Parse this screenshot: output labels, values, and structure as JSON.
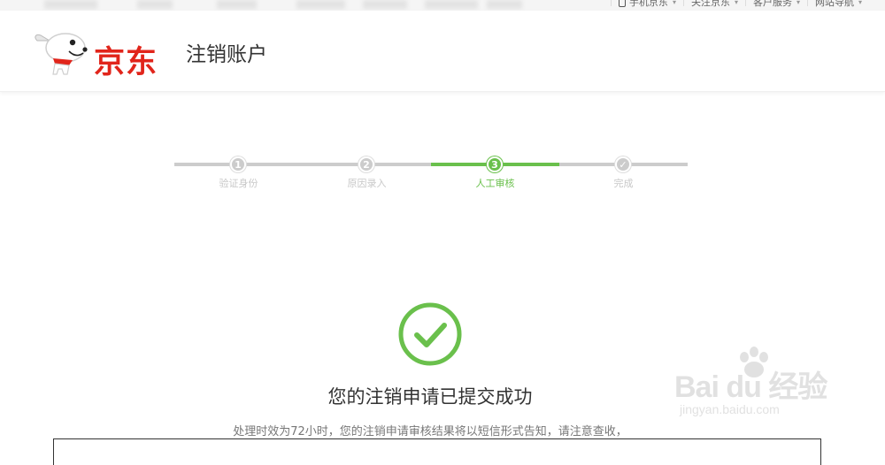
{
  "topbar": {
    "links": [
      {
        "label": "手机京东"
      },
      {
        "label": "关注京东"
      },
      {
        "label": "客户服务"
      },
      {
        "label": "网站导航"
      }
    ]
  },
  "header": {
    "logo_text": "京东",
    "title": "注销账户"
  },
  "stepper": {
    "steps": [
      {
        "number": "1",
        "label": "验证身份"
      },
      {
        "number": "2",
        "label": "原因录入"
      },
      {
        "number": "3",
        "label": "人工审核"
      },
      {
        "number": "✓",
        "label": "完成"
      }
    ],
    "active_index": 2
  },
  "result": {
    "title": "您的注销申请已提交成功",
    "description": "处理时效为72小时，您的注销申请审核结果将以短信形式告知，请注意查收，"
  },
  "watermark": {
    "main": "Bai du 经验",
    "sub": "jingyan.baidu.com"
  },
  "colors": {
    "brand_red": "#e1251b",
    "success_green": "#6ac04c",
    "step_gray": "#cccccc"
  },
  "icons": {
    "success": "check-circle-icon",
    "phone": "phone-icon",
    "logo": "jd-dog-mascot"
  }
}
